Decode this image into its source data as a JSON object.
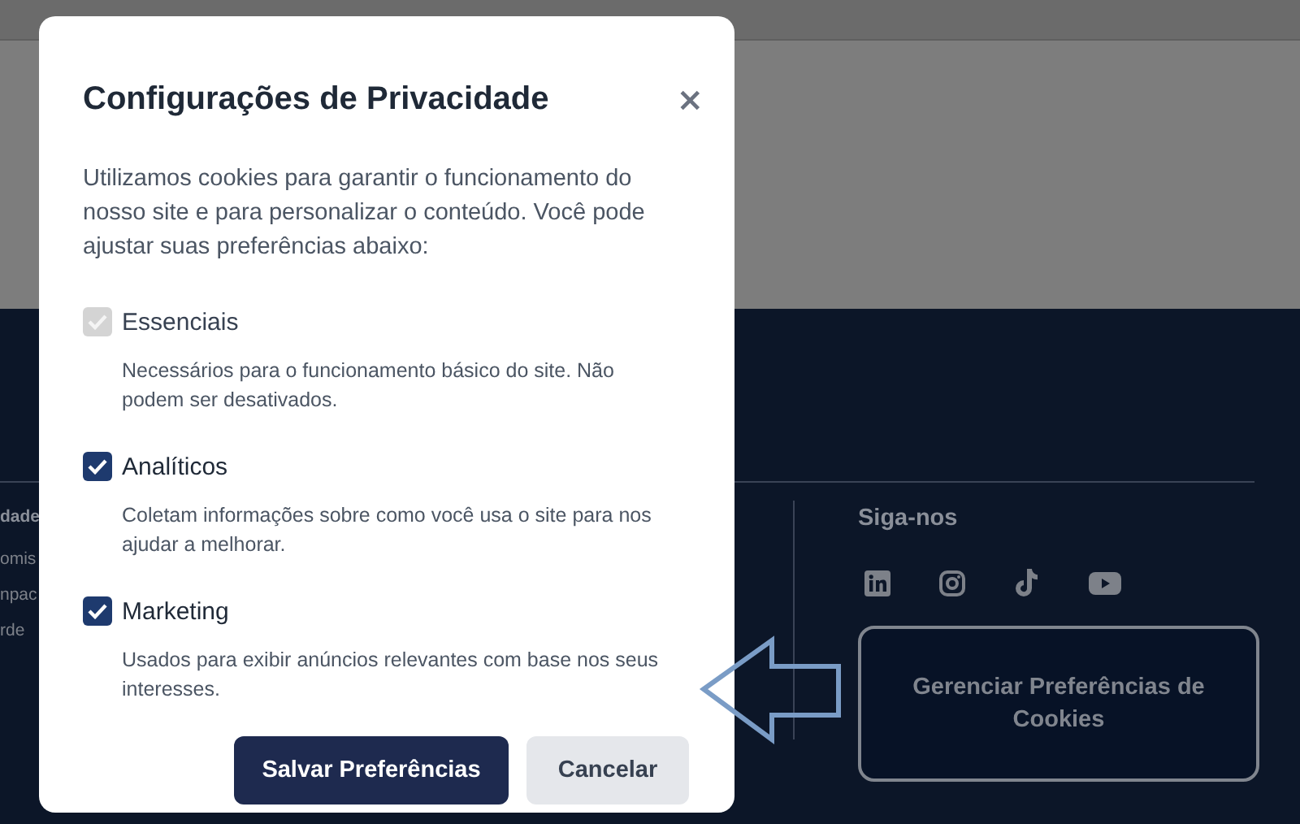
{
  "footer": {
    "left_column": {
      "heading": "dade",
      "links": [
        "omis",
        "npac",
        "rde"
      ]
    },
    "social": {
      "heading": "Siga-nos",
      "icons": [
        {
          "kind": "linkedin"
        },
        {
          "kind": "instagram"
        },
        {
          "kind": "tiktok"
        },
        {
          "kind": "youtube"
        }
      ]
    },
    "manage_button": "Gerenciar Preferências de Cookies"
  },
  "modal": {
    "title": "Configurações de Privacidade",
    "close": "×",
    "intro": "Utilizamos cookies para garantir o funcionamento do nosso site e para personalizar o conteúdo. Você pode ajustar suas preferências abaixo:",
    "options": [
      {
        "label": "Essenciais",
        "description": "Necessários para o funcionamento básico do site. Não podem ser desativados.",
        "checked": true,
        "disabled": true
      },
      {
        "label": "Analíticos",
        "description": "Coletam informações sobre como você usa o site para nos ajudar a melhorar.",
        "checked": true,
        "disabled": false
      },
      {
        "label": "Marketing",
        "description": "Usados para exibir anúncios relevantes com base nos seus interesses.",
        "checked": true,
        "disabled": false
      }
    ],
    "buttons": [
      {
        "label": "Salvar Preferências",
        "kind": "primary"
      },
      {
        "label": "Cancelar",
        "kind": "secondary"
      }
    ]
  }
}
